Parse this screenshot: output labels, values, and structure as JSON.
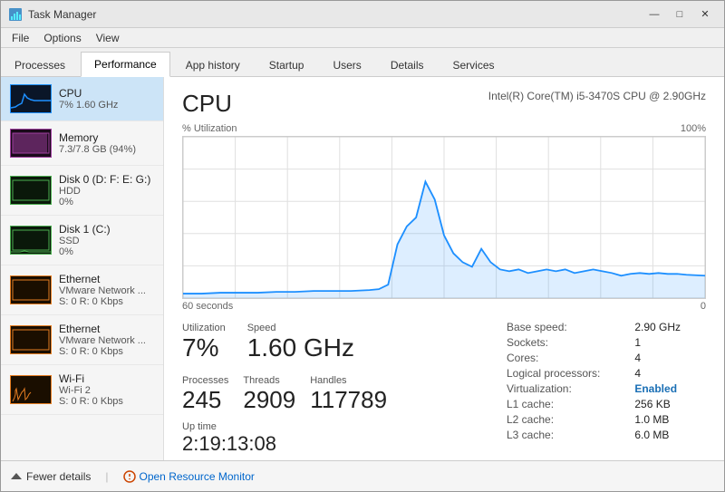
{
  "window": {
    "title": "Task Manager",
    "controls": [
      "—",
      "□",
      "✕"
    ]
  },
  "menu": {
    "items": [
      "File",
      "Options",
      "View"
    ]
  },
  "tabs": {
    "items": [
      "Processes",
      "Performance",
      "App history",
      "Startup",
      "Users",
      "Details",
      "Services"
    ],
    "active": "Performance"
  },
  "sidebar": {
    "items": [
      {
        "id": "cpu",
        "name": "CPU",
        "sub1": "7% 1.60 GHz",
        "sub2": "",
        "active": true
      },
      {
        "id": "memory",
        "name": "Memory",
        "sub1": "7.3/7.8 GB (94%)",
        "sub2": "",
        "active": false
      },
      {
        "id": "disk0",
        "name": "Disk 0 (D: F: E: G:)",
        "sub1": "HDD",
        "sub2": "0%",
        "active": false
      },
      {
        "id": "disk1",
        "name": "Disk 1 (C:)",
        "sub1": "SSD",
        "sub2": "0%",
        "active": false
      },
      {
        "id": "ethernet1",
        "name": "Ethernet",
        "sub1": "VMware Network ...",
        "sub2": "S: 0 R: 0 Kbps",
        "active": false
      },
      {
        "id": "ethernet2",
        "name": "Ethernet",
        "sub1": "VMware Network ...",
        "sub2": "S: 0 R: 0 Kbps",
        "active": false
      },
      {
        "id": "wifi",
        "name": "Wi-Fi",
        "sub1": "Wi-Fi 2",
        "sub2": "S: 0 R: 0 Kbps",
        "active": false
      }
    ]
  },
  "detail": {
    "title": "CPU",
    "subtitle": "Intel(R) Core(TM) i5-3470S CPU @ 2.90GHz",
    "chart": {
      "y_label": "% Utilization",
      "y_max": "100%",
      "x_label": "60 seconds",
      "x_right": "0"
    },
    "stats": {
      "utilization_label": "Utilization",
      "utilization_value": "7%",
      "speed_label": "Speed",
      "speed_value": "1.60 GHz",
      "processes_label": "Processes",
      "processes_value": "245",
      "threads_label": "Threads",
      "threads_value": "2909",
      "handles_label": "Handles",
      "handles_value": "117789",
      "uptime_label": "Up time",
      "uptime_value": "2:19:13:08"
    },
    "right_stats": {
      "items": [
        {
          "label": "Base speed:",
          "value": "2.90 GHz",
          "bold": false
        },
        {
          "label": "Sockets:",
          "value": "1",
          "bold": false
        },
        {
          "label": "Cores:",
          "value": "4",
          "bold": false
        },
        {
          "label": "Logical processors:",
          "value": "4",
          "bold": false
        },
        {
          "label": "Virtualization:",
          "value": "Enabled",
          "bold": true
        },
        {
          "label": "L1 cache:",
          "value": "256 KB",
          "bold": false
        },
        {
          "label": "L2 cache:",
          "value": "1.0 MB",
          "bold": false
        },
        {
          "label": "L3 cache:",
          "value": "6.0 MB",
          "bold": false
        }
      ]
    }
  },
  "footer": {
    "fewer_details": "Fewer details",
    "open_monitor": "Open Resource Monitor"
  }
}
